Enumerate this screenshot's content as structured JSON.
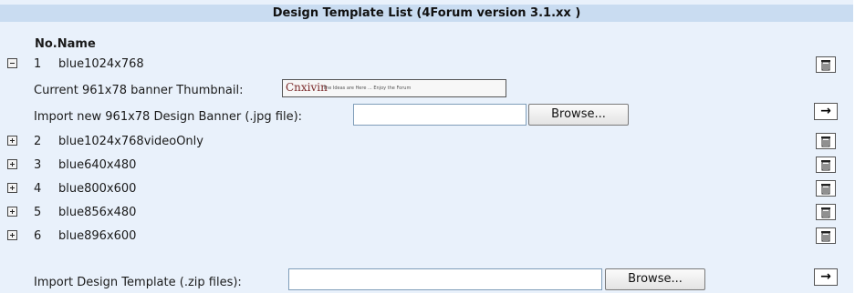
{
  "title": "Design Template List (4Forum version 3.1.xx )",
  "header": {
    "no_name": "No.Name"
  },
  "expanded": {
    "no": "1",
    "name": "blue1024x768",
    "thumb_label": "Current 961x78 banner Thumbnail:",
    "thumb_brand": "Cnxivin",
    "thumb_tagline": "The Ideas are Here ... Enjoy the Forum",
    "import_label": "Import new 961x78 Design Banner (.jpg file):",
    "import_value": "",
    "browse_label": "Browse...",
    "go_label": "→"
  },
  "templates": [
    {
      "no": "2",
      "name": "blue1024x768videoOnly"
    },
    {
      "no": "3",
      "name": "blue640x480"
    },
    {
      "no": "4",
      "name": "blue800x600"
    },
    {
      "no": "5",
      "name": "blue856x480"
    },
    {
      "no": "6",
      "name": "blue896x600"
    }
  ],
  "import_zip": {
    "label": "Import Design Template (.zip files):",
    "value": "",
    "browse_label": "Browse...",
    "go_label": "→"
  },
  "icons": {
    "expand": "plus-box-icon",
    "collapse": "minus-box-icon",
    "delete": "trash-icon",
    "submit": "arrow-right-icon"
  }
}
